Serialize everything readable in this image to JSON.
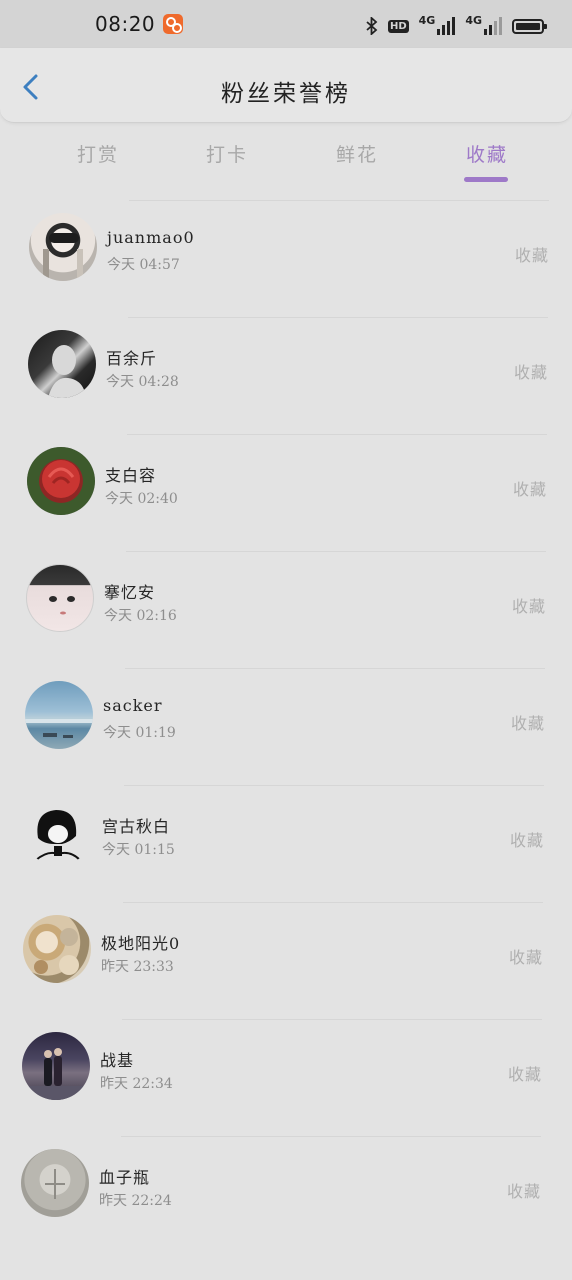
{
  "status_bar": {
    "time": "08:20",
    "hd_label": "HD",
    "network_1": "4G",
    "network_2": "4G"
  },
  "header": {
    "title": "粉丝荣誉榜"
  },
  "tabs": [
    {
      "label": "打赏",
      "active": false
    },
    {
      "label": "打卡",
      "active": false
    },
    {
      "label": "鲜花",
      "active": false
    },
    {
      "label": "收藏",
      "active": true
    }
  ],
  "accent_color": "#9e79c8",
  "fans": [
    {
      "name": "juanmao0",
      "time": "今天 04:57",
      "action": "收藏",
      "avatar": "woman-sunglasses-photo"
    },
    {
      "name": "百余斤",
      "time": "今天 04:28",
      "action": "收藏",
      "avatar": "bw-portrait-photo"
    },
    {
      "name": "支白容",
      "time": "今天 02:40",
      "action": "收藏",
      "avatar": "red-rose-photo"
    },
    {
      "name": "搴忆安",
      "time": "今天 02:16",
      "action": "收藏",
      "avatar": "girl-face-photo"
    },
    {
      "name": "sacker",
      "time": "今天 01:19",
      "action": "收藏",
      "avatar": "sky-sea-photo"
    },
    {
      "name": "宫古秋白",
      "time": "今天 01:15",
      "action": "收藏",
      "avatar": "bw-illustration"
    },
    {
      "name": "极地阳光0",
      "time": "昨天 23:33",
      "action": "收藏",
      "avatar": "food-table-photo"
    },
    {
      "name": "战基",
      "time": "昨天 22:34",
      "action": "收藏",
      "avatar": "couple-street-photo"
    },
    {
      "name": "血子瓶",
      "time": "昨天 22:24",
      "action": "收藏",
      "avatar": "foggy-photo"
    }
  ]
}
